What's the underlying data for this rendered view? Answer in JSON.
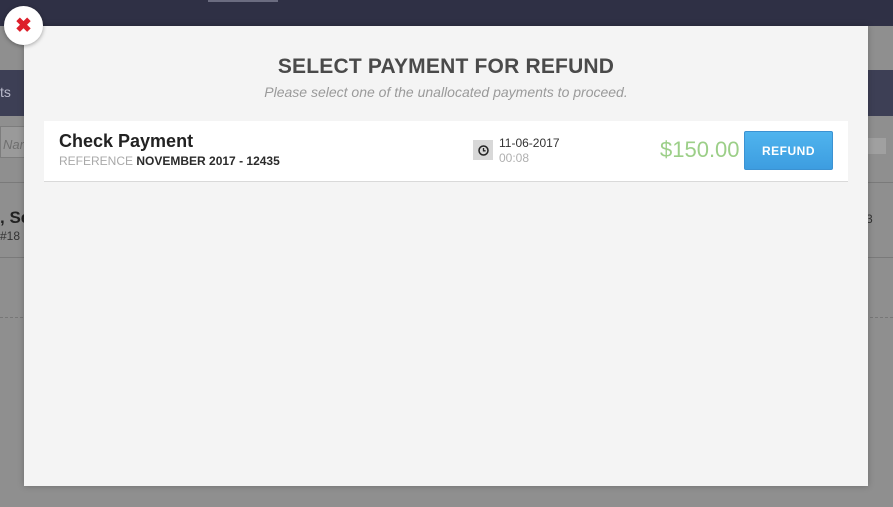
{
  "background": {
    "nav_text": "ts",
    "search_placeholder": "Nar",
    "customer_name": ", Se",
    "customer_number": "#18",
    "right_number": "3"
  },
  "modal": {
    "title": "SELECT PAYMENT FOR REFUND",
    "subtitle": "Please select one of the unallocated payments to proceed.",
    "close_icon": "close-icon",
    "payments": [
      {
        "title": "Check Payment",
        "reference_label": "REFERENCE",
        "reference_value": "NOVEMBER 2017 - 12435",
        "date": "11-06-2017",
        "time": "00:08",
        "amount": "$150.00",
        "button_label": "REFUND"
      }
    ]
  },
  "colors": {
    "amount": "#9ccf88",
    "button": "#45a9e8",
    "close": "#dd1e2a"
  }
}
